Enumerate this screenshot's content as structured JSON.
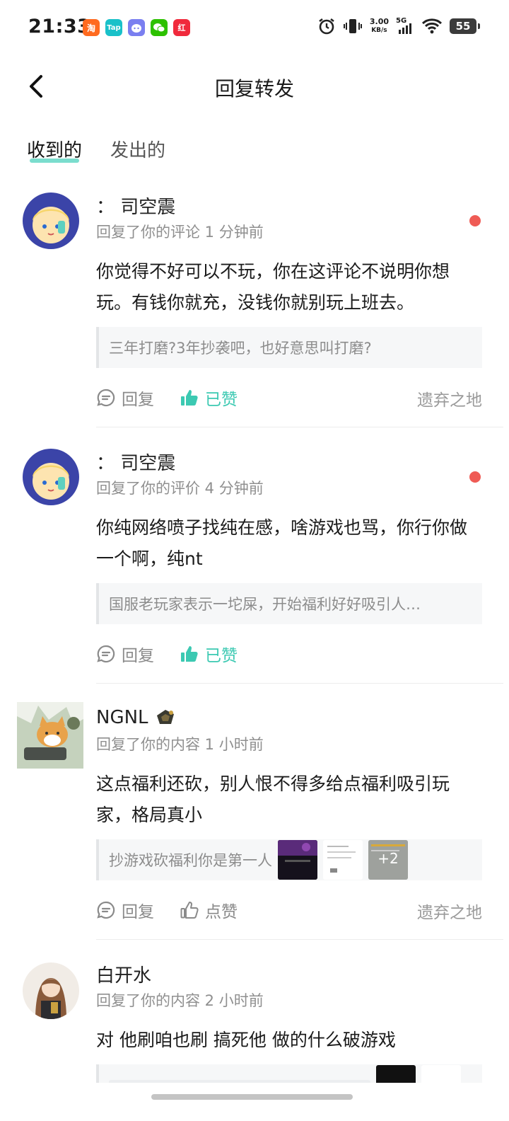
{
  "status_bar": {
    "time": "21:33",
    "net_speed": "3.00",
    "net_unit": "KB/s",
    "network": "5G",
    "battery": "55",
    "app_icons": [
      "淘",
      "Tap",
      "",
      "",
      "红"
    ]
  },
  "header": {
    "title": "回复转发",
    "back_icon": "chevron-left-icon"
  },
  "tabs": [
    {
      "label": "收到的",
      "active": true
    },
    {
      "label": "发出的",
      "active": false
    }
  ],
  "items": [
    {
      "name": "：  司空震",
      "meta": "回复了你的评论 1 分钟前",
      "unread": true,
      "body": "你觉得不好可以不玩，你在这评论不说明你想玩。有钱你就充，没钱你就别玩上班去。",
      "quote": "三年打磨?3年抄袭吧，也好意思叫打磨?",
      "reply_label": "回复",
      "like_label": "已赞",
      "liked": true,
      "source": "遗弃之地"
    },
    {
      "name": "：  司空震",
      "meta": "回复了你的评价 4 分钟前",
      "unread": true,
      "body": "你纯网络喷子找纯在感，啥游戏也骂，你行你做一个啊，纯nt",
      "quote": "国服老玩家表示一坨屎，开始福利好好吸引人…",
      "reply_label": "回复",
      "like_label": "已赞",
      "liked": true,
      "source": ""
    },
    {
      "name": "NGNL",
      "meta": "回复了你的内容 1 小时前",
      "unread": false,
      "body": "这点福利还砍，别人恨不得多给点福利吸引玩家，格局真小",
      "quote": "抄游戏砍福利你是第一人",
      "thumb_more": "+2",
      "reply_label": "回复",
      "like_label": "点赞",
      "liked": false,
      "source": "遗弃之地"
    },
    {
      "name": "白开水",
      "meta": "回复了你的内容 2 小时前",
      "unread": false,
      "body": "对 他刷咱也刷 搞死他  做的什么破游戏"
    }
  ]
}
